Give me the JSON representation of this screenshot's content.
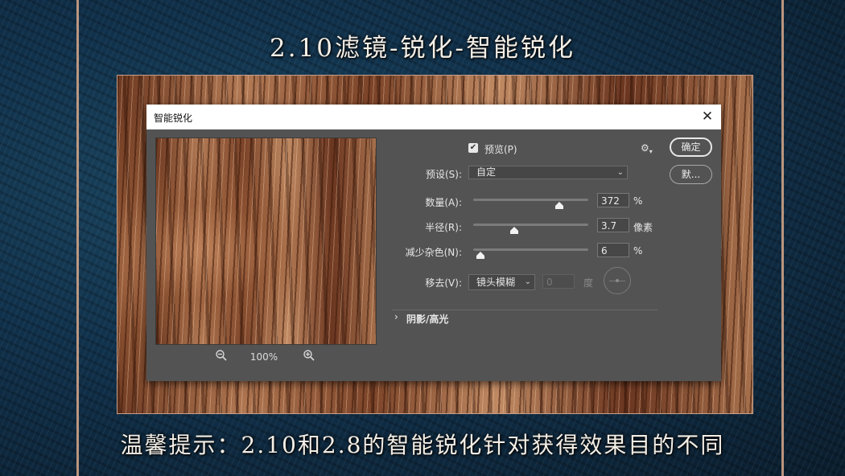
{
  "slide": {
    "title": "2.10滤镜-锐化-智能锐化",
    "tip": "温馨提示：2.10和2.8的智能锐化针对获得效果目的不同"
  },
  "dialog": {
    "title": "智能锐化",
    "preview_checkbox": {
      "label": "预览(P)",
      "checked": true
    },
    "preset": {
      "label": "预设(S):",
      "value": "自定"
    },
    "amount": {
      "label": "数量(A):",
      "value": "372",
      "unit": "%",
      "slider_fraction": 0.75
    },
    "radius": {
      "label": "半径(R):",
      "value": "3.7",
      "unit": "像素",
      "slider_fraction": 0.36
    },
    "noise": {
      "label": "减少杂色(N):",
      "value": "6",
      "unit": "%",
      "slider_fraction": 0.06
    },
    "remove": {
      "label": "移去(V):",
      "value": "镜头模糊",
      "angle_value": "0",
      "angle_unit": "度"
    },
    "shadows_highlights": {
      "label": "阴影/高光"
    },
    "zoom": {
      "value": "100%"
    },
    "buttons": {
      "ok": "确定",
      "reset": "默..."
    },
    "icons": [
      "close-icon",
      "zoom-out-icon",
      "zoom-in-icon",
      "gear-icon",
      "checkmark-icon",
      "chevron-down-icon",
      "chevron-right-icon",
      "angle-dial-icon"
    ]
  },
  "colors": {
    "dialog_bg": "#535353",
    "titlebar_bg": "#ffffff",
    "slide_bg": "#0f2a3c",
    "frame_accent": "#d9a98c",
    "wood": "#9a5f3d"
  }
}
